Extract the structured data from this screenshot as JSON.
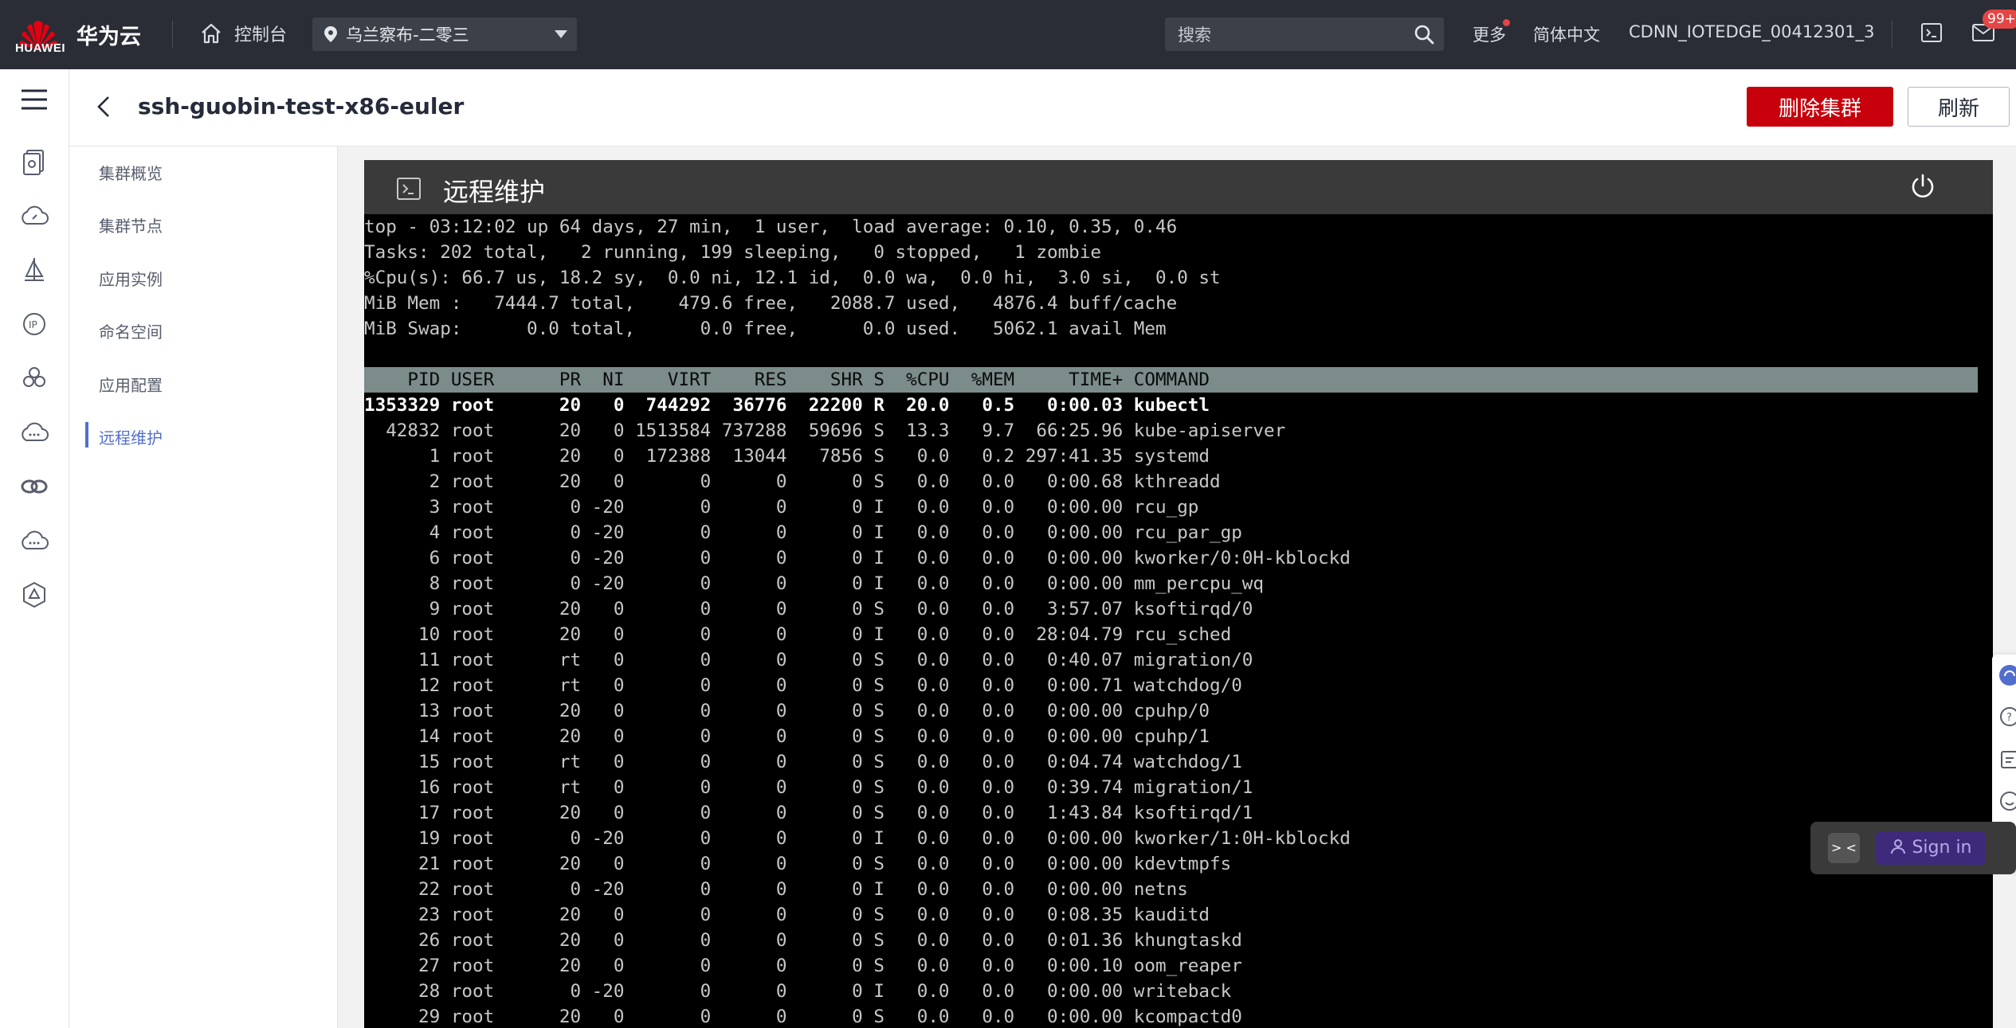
{
  "topbar": {
    "logo_text": "HUAWEI",
    "brand": "华为云",
    "console_label": "控制台",
    "region": "乌兰察布-二零三",
    "search_placeholder": "搜索",
    "more": "更多",
    "language": "简体中文",
    "account": "CDNN_IOTEDGE_00412301_3",
    "badge": "99+"
  },
  "header": {
    "title": "ssh-guobin-test-x86-euler",
    "delete_button": "删除集群",
    "refresh_button": "刷新"
  },
  "subnav": {
    "items": [
      {
        "label": "集群概览"
      },
      {
        "label": "集群节点"
      },
      {
        "label": "应用实例"
      },
      {
        "label": "命名空间"
      },
      {
        "label": "应用配置"
      },
      {
        "label": "远程维护",
        "active": true
      }
    ]
  },
  "panel": {
    "title": "远程维护"
  },
  "terminal": {
    "summary": [
      "top - 03:12:02 up 64 days, 27 min,  1 user,  load average: 0.10, 0.35, 0.46",
      "Tasks: 202 total,   2 running, 199 sleeping,   0 stopped,   1 zombie",
      "%Cpu(s): 66.7 us, 18.2 sy,  0.0 ni, 12.1 id,  0.0 wa,  0.0 hi,  3.0 si,  0.0 st",
      "MiB Mem :   7444.7 total,    479.6 free,   2088.7 used,   4876.4 buff/cache",
      "MiB Swap:      0.0 total,      0.0 free,      0.0 used.   5062.1 avail Mem"
    ],
    "column_header": "    PID USER      PR  NI    VIRT    RES    SHR S  %CPU  %MEM     TIME+ COMMAND",
    "processes": [
      "1353329 root      20   0  744292  36776  22200 R  20.0   0.5   0:00.03 kubectl",
      "  42832 root      20   0 1513584 737288  59696 S  13.3   9.7  66:25.96 kube-apiserver",
      "      1 root      20   0  172388  13044   7856 S   0.0   0.2 297:41.35 systemd",
      "      2 root      20   0       0      0      0 S   0.0   0.0   0:00.68 kthreadd",
      "      3 root       0 -20       0      0      0 I   0.0   0.0   0:00.00 rcu_gp",
      "      4 root       0 -20       0      0      0 I   0.0   0.0   0:00.00 rcu_par_gp",
      "      6 root       0 -20       0      0      0 I   0.0   0.0   0:00.00 kworker/0:0H-kblockd",
      "      8 root       0 -20       0      0      0 I   0.0   0.0   0:00.00 mm_percpu_wq",
      "      9 root      20   0       0      0      0 S   0.0   0.0   3:57.07 ksoftirqd/0",
      "     10 root      20   0       0      0      0 I   0.0   0.0  28:04.79 rcu_sched",
      "     11 root      rt   0       0      0      0 S   0.0   0.0   0:40.07 migration/0",
      "     12 root      rt   0       0      0      0 S   0.0   0.0   0:00.71 watchdog/0",
      "     13 root      20   0       0      0      0 S   0.0   0.0   0:00.00 cpuhp/0",
      "     14 root      20   0       0      0      0 S   0.0   0.0   0:00.00 cpuhp/1",
      "     15 root      rt   0       0      0      0 S   0.0   0.0   0:04.74 watchdog/1",
      "     16 root      rt   0       0      0      0 S   0.0   0.0   0:39.74 migration/1",
      "     17 root      20   0       0      0      0 S   0.0   0.0   1:43.84 ksoftirqd/1",
      "     19 root       0 -20       0      0      0 I   0.0   0.0   0:00.00 kworker/1:0H-kblockd",
      "     21 root      20   0       0      0      0 S   0.0   0.0   0:00.00 kdevtmpfs",
      "     22 root       0 -20       0      0      0 I   0.0   0.0   0:00.00 netns",
      "     23 root      20   0       0      0      0 S   0.0   0.0   0:08.35 kauditd",
      "     26 root      20   0       0      0      0 S   0.0   0.0   0:01.36 khungtaskd",
      "     27 root      20   0       0      0      0 S   0.0   0.0   0:00.10 oom_reaper",
      "     28 root       0 -20       0      0      0 I   0.0   0.0   0:00.00 writeback",
      "     29 root      20   0       0      0      0 S   0.0   0.0   0:00.00 kcompactd0"
    ]
  },
  "float": {
    "signin": "Sign in",
    "face": "> <"
  },
  "colors": {
    "topbar": "#2a2d36",
    "danger": "#c7000b",
    "accent": "#526ecc",
    "terminal_bg": "#000000",
    "terminal_header": "#7b8c8a"
  },
  "icons": {
    "rail": [
      "menu-icon",
      "cluster-icon",
      "dashboard-cloud-icon",
      "sail-icon",
      "ip-icon",
      "cluster-cloud-icon",
      "cloud-chat-icon",
      "link-icon",
      "cloud-dots-icon",
      "ai-icon"
    ]
  }
}
